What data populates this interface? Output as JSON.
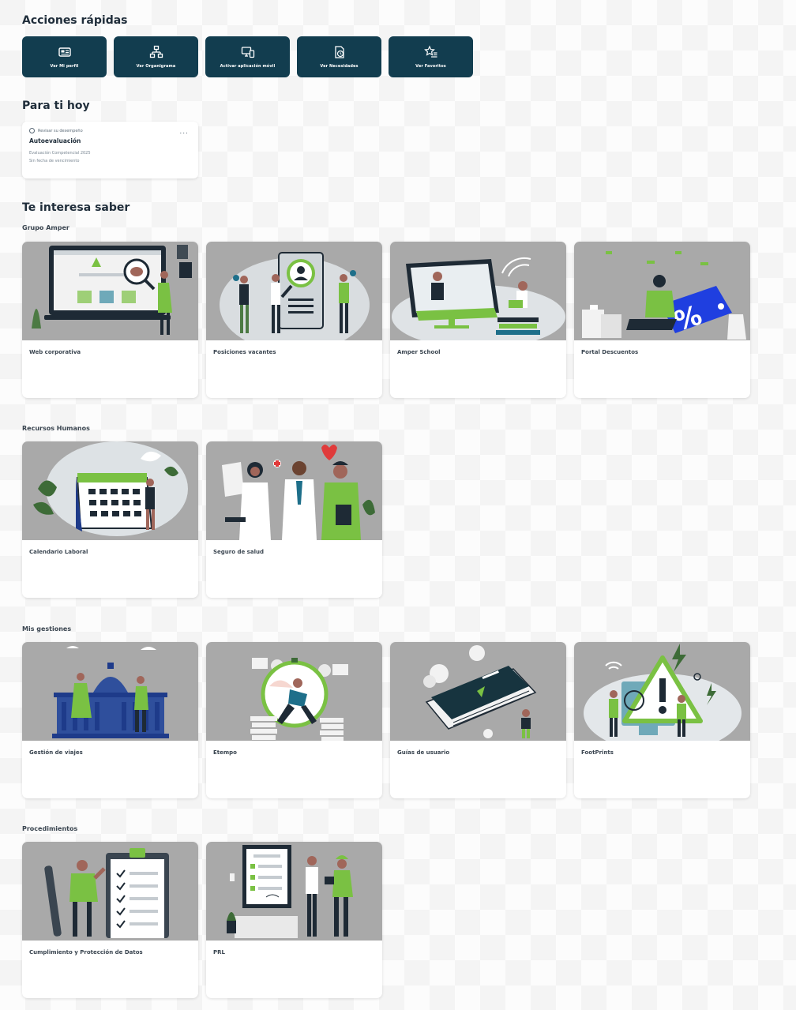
{
  "quick_actions": {
    "title": "Acciones rápidas",
    "buttons": [
      {
        "label": "Ver Mi perfil",
        "icon": "id-card-icon"
      },
      {
        "label": "Ver Organigrama",
        "icon": "org-chart-icon"
      },
      {
        "label": "Activar aplicación móvil",
        "icon": "mobile-devices-icon"
      },
      {
        "label": "Ver Necesidades",
        "icon": "document-clock-icon"
      },
      {
        "label": "Ver Favoritos",
        "icon": "star-list-icon"
      }
    ],
    "color": "#123d4f"
  },
  "today": {
    "title": "Para ti hoy",
    "task": {
      "category": "Revisar su desempeño",
      "title": "Autoevaluación",
      "subtitle": "Evaluación Competencial 2025",
      "due": "Sin fecha de vencimiento",
      "more": "..."
    }
  },
  "interest": {
    "title": "Te interesa saber",
    "groups": [
      {
        "title": "Grupo Amper",
        "cards": [
          "Web corporativa",
          "Posiciones vacantes",
          "Amper School",
          "Portal Descuentos"
        ]
      },
      {
        "title": "Recursos Humanos",
        "cards": [
          "Calendario Laboral",
          "Seguro de salud"
        ]
      },
      {
        "title": "Mis gestiones",
        "cards": [
          "Gestión de viajes",
          "Etempo",
          "Guías de usuario",
          "FootPrints"
        ]
      },
      {
        "title": "Procedimientos",
        "cards": [
          "Cumplimiento y Protección de Datos",
          "PRL"
        ]
      }
    ]
  },
  "colors": {
    "accent_green": "#7ac143",
    "dark_blue": "#123d4f",
    "image_gray": "#a9a9a9"
  }
}
